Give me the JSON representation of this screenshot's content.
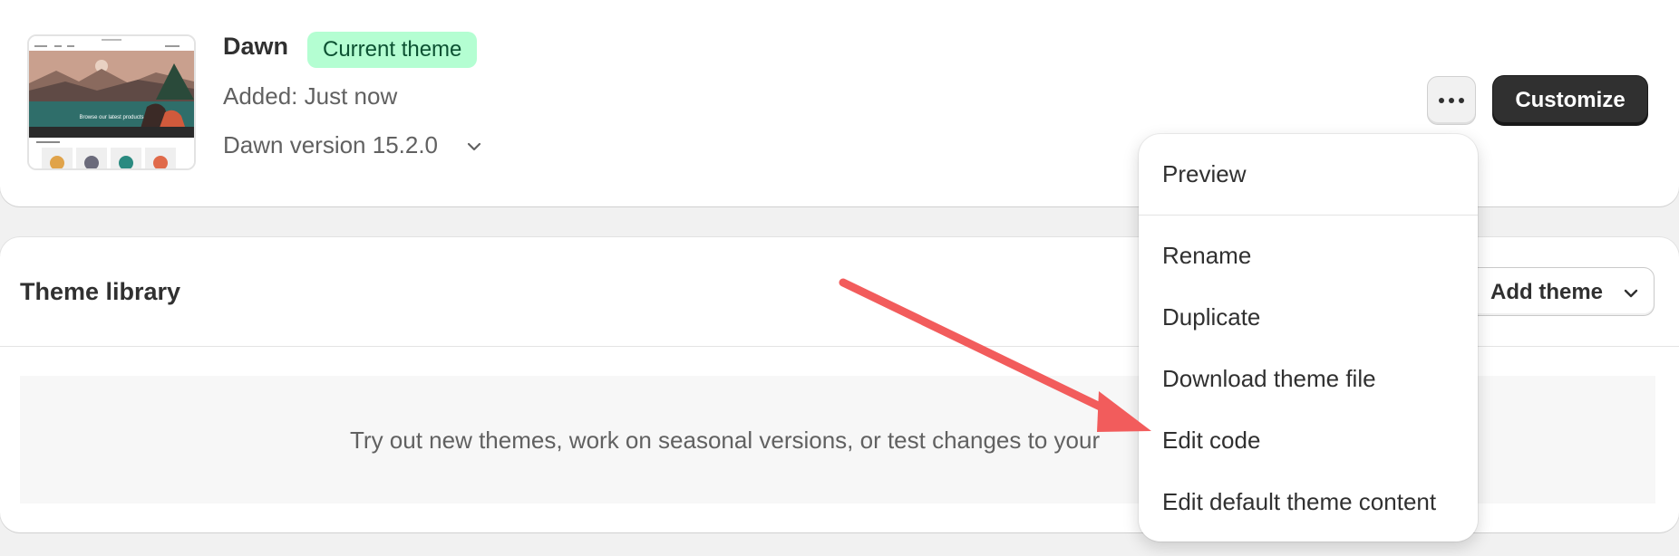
{
  "current_theme": {
    "name": "Dawn",
    "badge": "Current theme",
    "added": "Added: Just now",
    "version": "Dawn version 15.2.0",
    "thumbnail_caption": "Browse our latest products",
    "customize_label": "Customize"
  },
  "theme_library": {
    "title": "Theme library",
    "add_theme_label": "Add theme",
    "empty_text": "Try out new themes, work on seasonal versions, or test changes to your"
  },
  "actions_menu": {
    "items": [
      "Preview",
      "Rename",
      "Duplicate",
      "Download theme file",
      "Edit code",
      "Edit default theme content"
    ]
  },
  "icons": {
    "more": "ellipsis-icon",
    "chevron": "chevron-down-icon",
    "annotation": "red-arrow"
  },
  "colors": {
    "badge_bg": "#b4fed2",
    "badge_text": "#0c5132",
    "primary_button": "#303030",
    "annotation_arrow": "#f25c5c"
  }
}
